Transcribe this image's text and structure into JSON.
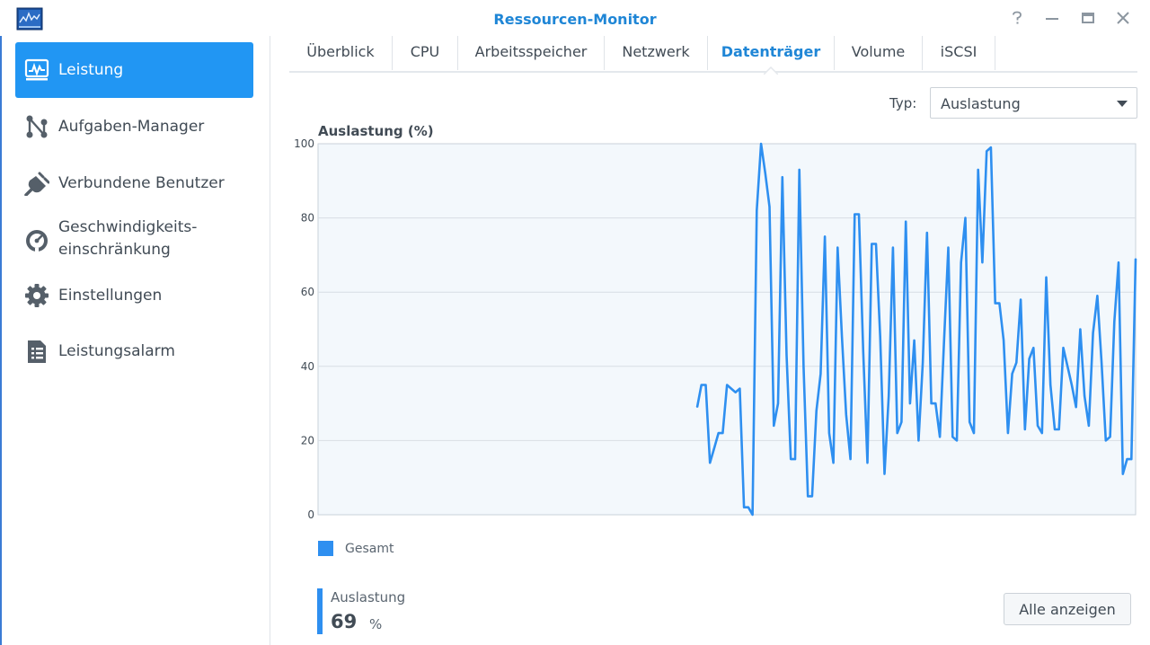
{
  "window": {
    "title": "Ressourcen-Monitor",
    "help_icon": "help-icon",
    "minimize_icon": "minimize-icon",
    "maximize_icon": "maximize-icon",
    "close_icon": "close-icon"
  },
  "sidebar": {
    "items": [
      {
        "label": "Leistung",
        "icon": "performance-monitor-icon",
        "active": true
      },
      {
        "label": "Aufgaben-Manager",
        "icon": "task-manager-icon",
        "active": false
      },
      {
        "label": "Verbundene Benutzer",
        "icon": "plug-icon",
        "active": false
      },
      {
        "label_line1": "Geschwindigkeits-",
        "label_line2": "einschränkung",
        "icon": "speedometer-icon",
        "active": false
      },
      {
        "label": "Einstellungen",
        "icon": "gear-icon",
        "active": false
      },
      {
        "label": "Leistungsalarm",
        "icon": "alarm-list-icon",
        "active": false
      }
    ]
  },
  "tabs": [
    {
      "label": "Überblick",
      "active": false
    },
    {
      "label": "CPU",
      "active": false
    },
    {
      "label": "Arbeitsspeicher",
      "active": false
    },
    {
      "label": "Netzwerk",
      "active": false
    },
    {
      "label": "Datenträger",
      "active": true
    },
    {
      "label": "Volume",
      "active": false
    },
    {
      "label": "iSCSI",
      "active": false
    }
  ],
  "type_selector": {
    "label": "Typ:",
    "value": "Auslastung"
  },
  "chart_data": {
    "type": "line",
    "title": "Auslastung (%)",
    "xlabel": "",
    "ylabel": "",
    "ylim": [
      0,
      100
    ],
    "yticks": [
      0,
      20,
      40,
      60,
      80,
      100
    ],
    "grid": true,
    "legend_position": "bottom-left",
    "color": "#2e8ff0",
    "series": [
      {
        "name": "Gesamt",
        "values": [
          29,
          35,
          35,
          14,
          18,
          22,
          22,
          35,
          34,
          33,
          34,
          2,
          2,
          0,
          82,
          100,
          92,
          83,
          24,
          30,
          91,
          43,
          15,
          15,
          93,
          40,
          5,
          5,
          28,
          38,
          75,
          22,
          14,
          72,
          48,
          27,
          15,
          81,
          81,
          44,
          14,
          73,
          73,
          48,
          11,
          32,
          72,
          22,
          25,
          79,
          30,
          47,
          20,
          41,
          76,
          30,
          30,
          21,
          47,
          72,
          21,
          20,
          68,
          80,
          25,
          22,
          93,
          68,
          98,
          99,
          57,
          57,
          47,
          22,
          38,
          41,
          58,
          23,
          42,
          45,
          24,
          22,
          64,
          35,
          23,
          23,
          45,
          40,
          35,
          29,
          50,
          32,
          24,
          49,
          59,
          41,
          20,
          21,
          52,
          68,
          11,
          15,
          15,
          69
        ]
      }
    ]
  },
  "summary": {
    "label": "Auslastung",
    "value": "69",
    "unit": "%"
  },
  "show_all_button": "Alle anzeigen"
}
